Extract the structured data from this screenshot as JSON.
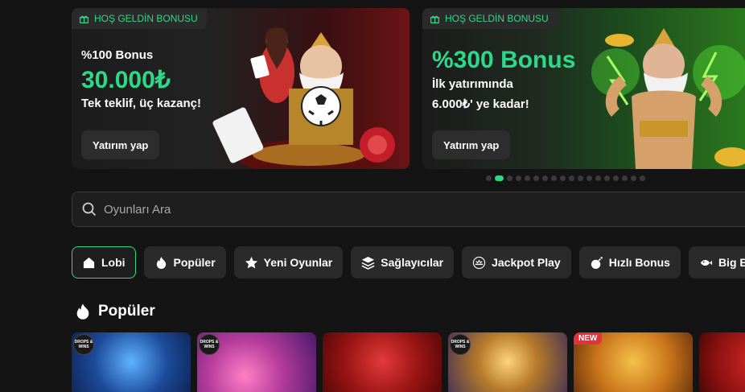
{
  "banners": [
    {
      "tag": "HOŞ GELDİN BONUSU",
      "line1": "%100 Bonus",
      "amount": "30.000₺",
      "subtitle": "Tek teklif, üç kazanç!",
      "button": "Yatırım yap"
    },
    {
      "tag": "HOŞ GELDİN BONUSU",
      "amount": "%300 Bonus",
      "subtitle_line1": "İlk yatırımında",
      "subtitle_line2": "6.000₺' ye kadar!",
      "button": "Yatırım yap"
    }
  ],
  "carousel": {
    "total": 18,
    "active_index": 1
  },
  "search": {
    "placeholder": "Oyunları Ara"
  },
  "categories": [
    {
      "label": "Lobi",
      "icon": "home-icon",
      "active": true
    },
    {
      "label": "Popüler",
      "icon": "flame-icon"
    },
    {
      "label": "Yeni Oyunlar",
      "icon": "star-icon"
    },
    {
      "label": "Sağlayıcılar",
      "icon": "layers-icon"
    },
    {
      "label": "Jackpot Play",
      "icon": "jackpot-icon"
    },
    {
      "label": "Hızlı Bonus",
      "icon": "bomb-icon"
    },
    {
      "label": "Big Bass",
      "icon": "fish-icon"
    }
  ],
  "section": {
    "title": "Popüler"
  },
  "games": [
    {
      "badge": "DROPS & WINS"
    },
    {
      "badge": "DROPS & WINS"
    },
    {
      "badge": ""
    },
    {
      "badge": "DROPS & WINS"
    },
    {
      "badge": "NEW"
    },
    {
      "badge": ""
    }
  ],
  "colors": {
    "accent": "#2ed889",
    "background": "#141414",
    "chip": "#2a2a2a"
  }
}
